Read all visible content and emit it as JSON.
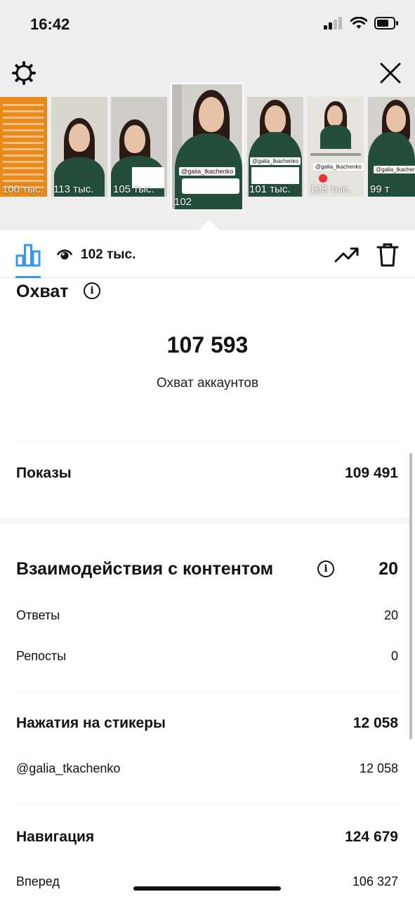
{
  "status_bar": {
    "time": "16:42"
  },
  "stories": [
    {
      "views": "100 тыс."
    },
    {
      "views": "113 тыс."
    },
    {
      "views": "105 тыс."
    },
    {
      "views": "102",
      "tag": "@galia_tkachenko",
      "selected": true
    },
    {
      "views": "101 тыс.",
      "tag": "@galia_tkachenko"
    },
    {
      "views": "103 тыс.",
      "tag": "@galia_tkachenko"
    },
    {
      "views": "99 т",
      "tag": "@galia_tkachenko"
    }
  ],
  "toolbar": {
    "views": "102 тыс."
  },
  "reach": {
    "title": "Охват",
    "value": "107 593",
    "caption": "Охват аккаунтов"
  },
  "impressions": {
    "label": "Показы",
    "value": "109 491"
  },
  "interactions": {
    "title": "Взаимодействия с контентом",
    "value": "20",
    "rows": [
      {
        "label": "Ответы",
        "value": "20"
      },
      {
        "label": "Репосты",
        "value": "0"
      }
    ]
  },
  "sticker_taps": {
    "label": "Нажатия на стикеры",
    "value": "12 058",
    "rows": [
      {
        "label": "@galia_tkachenko",
        "value": "12 058"
      }
    ]
  },
  "navigation": {
    "label": "Навигация",
    "value": "124 679",
    "rows": [
      {
        "label": "Вперед",
        "value": "106 327"
      }
    ]
  },
  "colors": {
    "accent": "#3897f0",
    "sweater": "#234e3b",
    "orange": "#e8891a"
  }
}
